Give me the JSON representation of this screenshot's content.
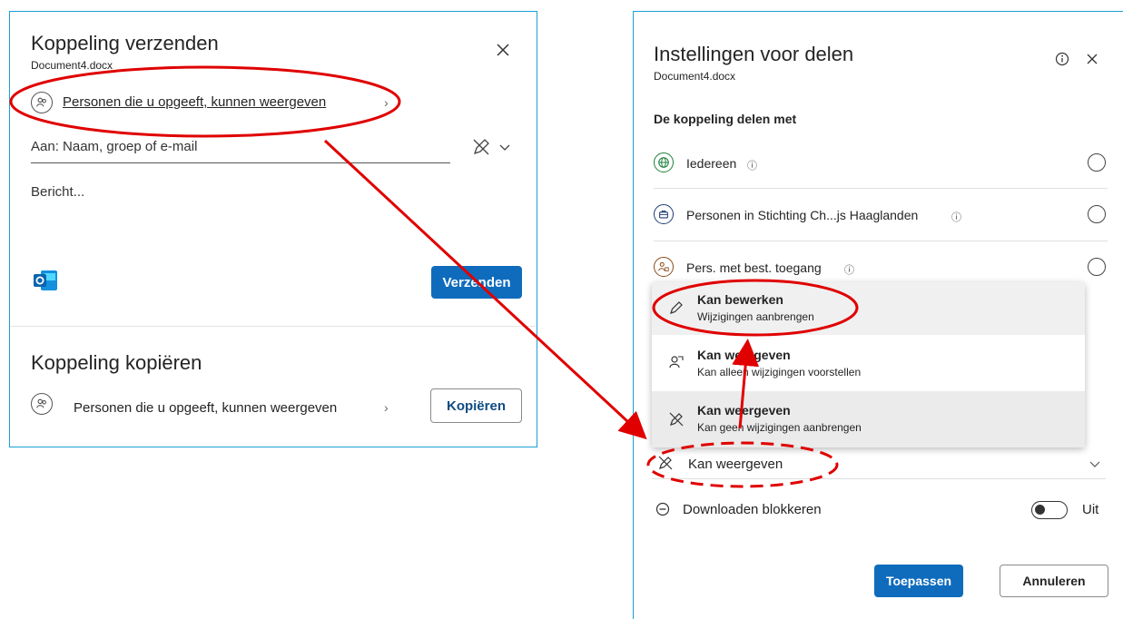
{
  "left_panel": {
    "send": {
      "title": "Koppeling verzenden",
      "filename": "Document4.docx",
      "scope_link": "Personen die u opgeeft, kunnen weergeven",
      "to_placeholder": "Aan: Naam, groep of e-mail",
      "message_placeholder": "Bericht...",
      "send_button": "Verzenden"
    },
    "copy": {
      "title": "Koppeling kopiëren",
      "scope_link": "Personen die u opgeeft, kunnen weergeven",
      "copy_button": "Kopiëren"
    }
  },
  "right_panel": {
    "title": "Instellingen voor delen",
    "filename": "Document4.docx",
    "share_with_heading": "De koppeling delen met",
    "options": [
      {
        "label": "Iedereen",
        "icon": "globe-icon"
      },
      {
        "label": "Personen in Stichting Ch...js Haaglanden",
        "icon": "briefcase-icon"
      },
      {
        "label": "Pers. met best. toegang",
        "icon": "people-lock-icon"
      }
    ],
    "permission_menu": [
      {
        "title": "Kan bewerken",
        "desc": "Wijzigingen aanbrengen",
        "icon": "pencil-icon"
      },
      {
        "title": "Kan weergeven",
        "desc": "Kan alleen wijzigingen voorstellen",
        "icon": "review-icon"
      },
      {
        "title": "Kan weergeven",
        "desc": "Kan geen wijzigingen aanbrengen",
        "icon": "no-edit-icon"
      }
    ],
    "permission_current": "Kan weergeven",
    "block_download_label": "Downloaden blokkeren",
    "toggle_state": "Uit",
    "apply_button": "Toepassen",
    "cancel_button": "Annuleren"
  },
  "colors": {
    "panel_border": "#1aa0d8",
    "primary": "#0f6cbd",
    "annotation": "#e00000"
  }
}
